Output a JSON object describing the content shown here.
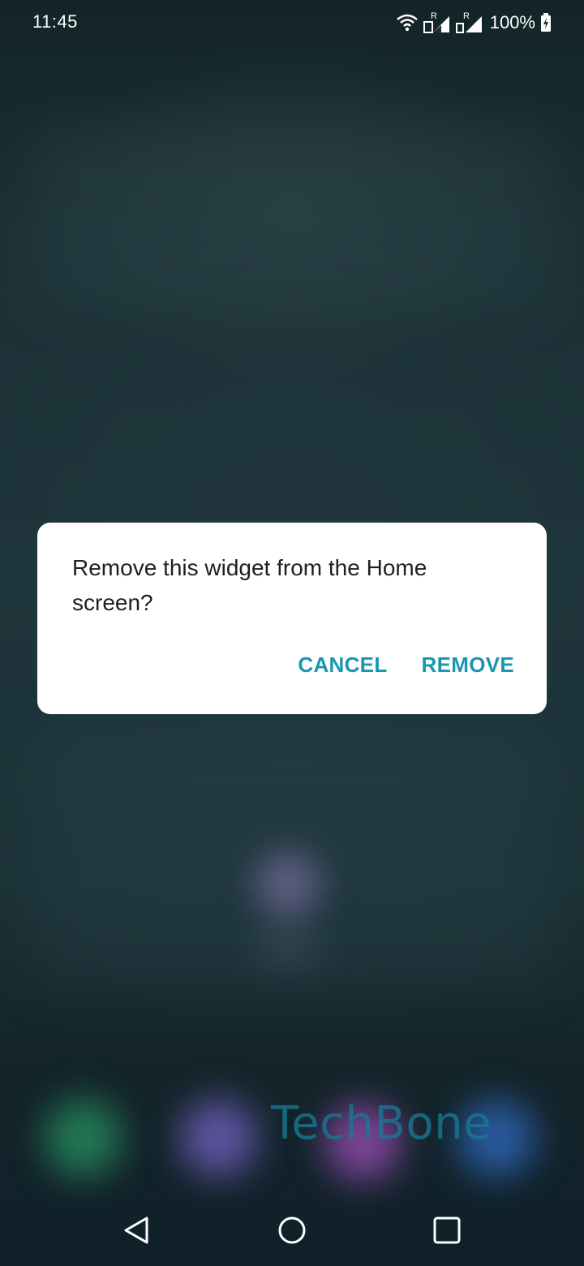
{
  "status_bar": {
    "time": "11:45",
    "battery": "100%",
    "icons": [
      "wifi-icon",
      "signal-icon",
      "signal-icon",
      "battery-icon"
    ],
    "roaming_label": "R"
  },
  "dialog": {
    "message": "Remove this widget from the Home screen?",
    "cancel_label": "CANCEL",
    "remove_label": "REMOVE",
    "accent_color": "#1797b1"
  },
  "watermark": {
    "text": "TechBone"
  },
  "nav_bar": {
    "icons": [
      "back-icon",
      "home-icon",
      "recents-icon"
    ]
  }
}
